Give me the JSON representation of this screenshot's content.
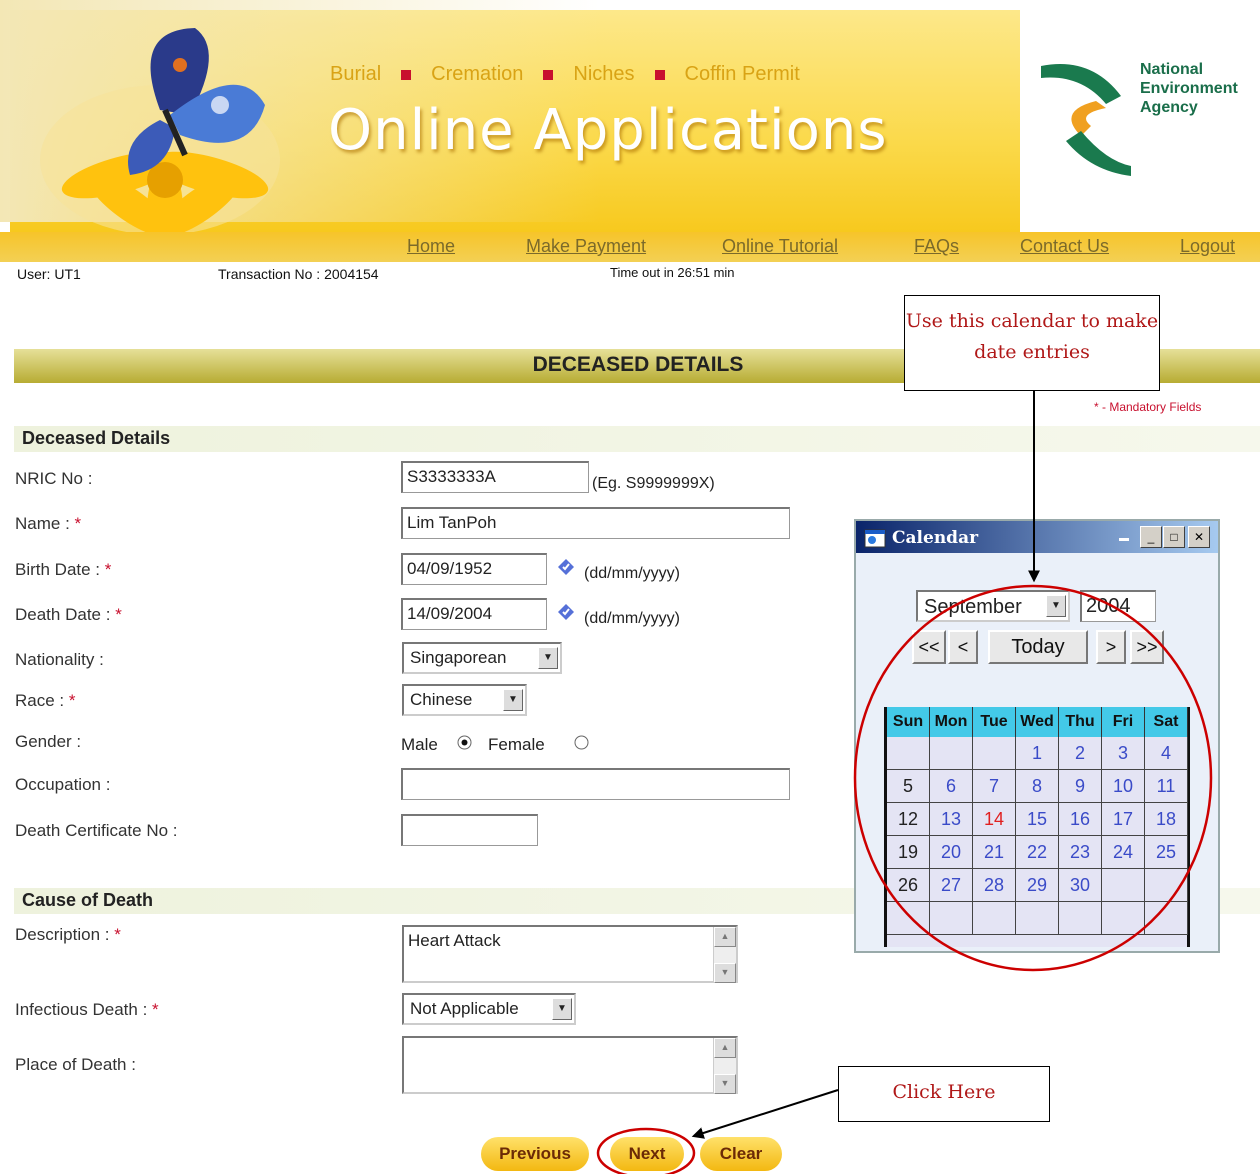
{
  "header": {
    "categories": [
      "Burial",
      "Cremation",
      "Niches",
      "Coffin Permit"
    ],
    "app_title": "Online Applications",
    "agency_lines": [
      "National",
      "Environment",
      "Agency"
    ]
  },
  "nav": {
    "items": [
      "Home",
      "Make Payment",
      "Online Tutorial",
      "FAQs",
      "Contact Us",
      "Logout"
    ]
  },
  "session": {
    "user": "User: UT1",
    "transaction": "Transaction No : 2004154",
    "timeout": "Time out in 26:51 min"
  },
  "page": {
    "title": "DECEASED DETAILS",
    "mandatory_note": "* - Mandatory Fields"
  },
  "deceased": {
    "section_title": "Deceased Details",
    "nric_label": "NRIC No :",
    "nric_value": "S3333333A",
    "nric_hint": "(Eg. S9999999X)",
    "name_label": "Name :",
    "name_value": "Lim TanPoh",
    "birth_label": "Birth Date :",
    "birth_value": "04/09/1952",
    "death_label": "Death Date :",
    "death_value": "14/09/2004",
    "date_hint": "(dd/mm/yyyy)",
    "nationality_label": "Nationality :",
    "nationality_value": "Singaporean",
    "race_label": "Race :",
    "race_value": "Chinese",
    "gender_label": "Gender :",
    "gender_male": "Male",
    "gender_female": "Female",
    "gender_selected": "Male",
    "occupation_label": "Occupation :",
    "occupation_value": "",
    "certificate_label": "Death Certificate No :",
    "certificate_value": "",
    "required_mark": "*"
  },
  "cause": {
    "section_title": "Cause of Death",
    "description_label": "Description :",
    "description_value": "Heart Attack",
    "infectious_label": "Infectious Death :",
    "infectious_value": "Not Applicable",
    "place_label": "Place of Death :",
    "place_value": ""
  },
  "buttons": {
    "previous": "Previous",
    "next": "Next",
    "clear": "Clear"
  },
  "calendar": {
    "window_title": "Calendar",
    "month": "September",
    "year": "2004",
    "prev_year": "<<",
    "prev_month": "<",
    "today": "Today",
    "next_month": ">",
    "next_year": ">>",
    "weekdays": [
      "Sun",
      "Mon",
      "Tue",
      "Wed",
      "Thu",
      "Fri",
      "Sat"
    ],
    "weeks": [
      [
        "",
        "",
        "",
        "1",
        "2",
        "3",
        "4"
      ],
      [
        "5",
        "6",
        "7",
        "8",
        "9",
        "10",
        "11"
      ],
      [
        "12",
        "13",
        "14",
        "15",
        "16",
        "17",
        "18"
      ],
      [
        "19",
        "20",
        "21",
        "22",
        "23",
        "24",
        "25"
      ],
      [
        "26",
        "27",
        "28",
        "29",
        "30",
        "",
        ""
      ],
      [
        "",
        "",
        "",
        "",
        "",
        "",
        ""
      ]
    ],
    "highlight_day": "14"
  },
  "annotations": {
    "calendar_tip": "Use this calendar to make date entries",
    "click_here": "Click Here"
  },
  "colors": {
    "banner_yellow": "#fbd94a",
    "required_red": "#c8102e",
    "calendar_header": "#43c9e8",
    "annotation_red": "#cc0000"
  }
}
